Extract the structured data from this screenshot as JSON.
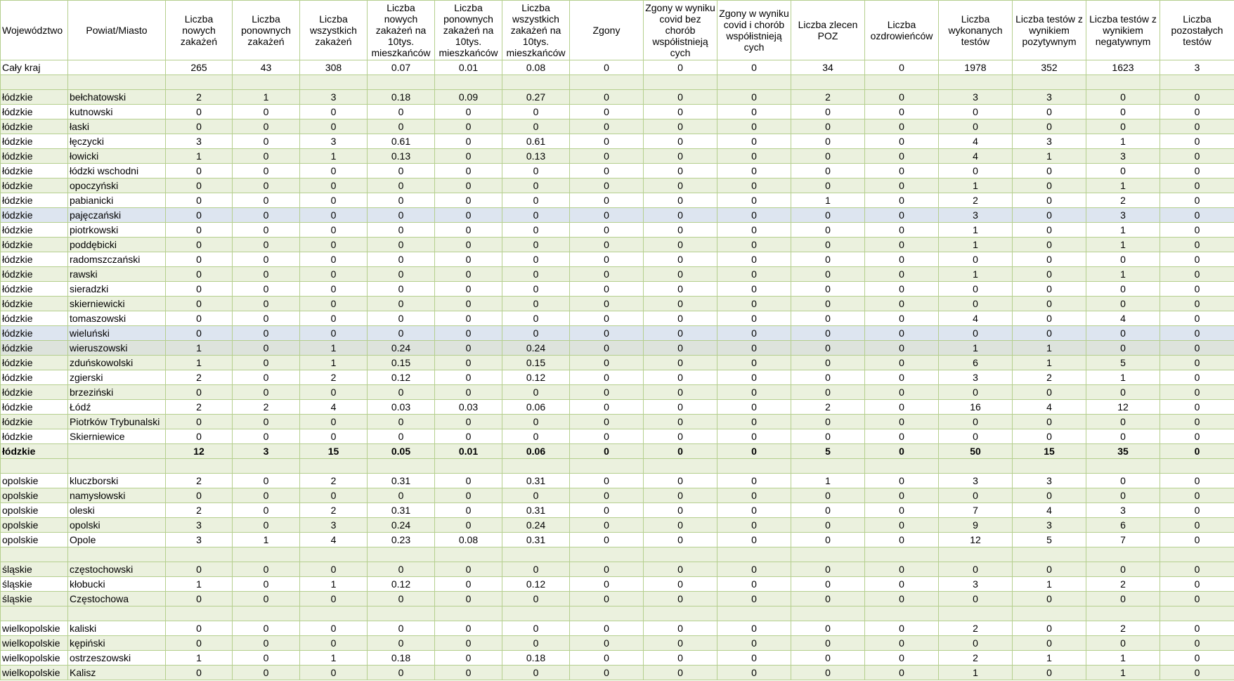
{
  "columns": [
    "Województwo",
    "Powiat/Miasto",
    "Liczba nowych zakażeń",
    "Liczba ponownych zakażeń",
    "Liczba wszystkich zakażeń",
    "Liczba nowych zakażeń na 10tys. mieszkańców",
    "Liczba ponownych zakażeń na 10tys. mieszkańców",
    "Liczba wszystkich zakażeń na 10tys. mieszkańców",
    "Zgony",
    "Zgony w wyniku covid bez chorób współistnieją cych",
    "Zgony w wyniku covid i chorób współistnieją cych",
    "Liczba zlecen POZ",
    "Liczba ozdrowieńców",
    "Liczba wykonanych testów",
    "Liczba testów z wynikiem pozytywnym",
    "Liczba testów z wynikiem negatywnym",
    "Liczba pozostałych testów"
  ],
  "rows": [
    {
      "cells": [
        "Cały kraj",
        "",
        "265",
        "43",
        "308",
        "0.07",
        "0.01",
        "0.08",
        "0",
        "0",
        "0",
        "34",
        "0",
        "1978",
        "352",
        "1623",
        "3"
      ]
    },
    {
      "blank": true,
      "cells": []
    },
    {
      "cells": [
        "łódzkie",
        "bełchatowski",
        "2",
        "1",
        "3",
        "0.18",
        "0.09",
        "0.27",
        "0",
        "0",
        "0",
        "2",
        "0",
        "3",
        "3",
        "0",
        "0"
      ]
    },
    {
      "cells": [
        "łódzkie",
        "kutnowski",
        "0",
        "0",
        "0",
        "0",
        "0",
        "0",
        "0",
        "0",
        "0",
        "0",
        "0",
        "0",
        "0",
        "0",
        "0"
      ]
    },
    {
      "cells": [
        "łódzkie",
        "łaski",
        "0",
        "0",
        "0",
        "0",
        "0",
        "0",
        "0",
        "0",
        "0",
        "0",
        "0",
        "0",
        "0",
        "0",
        "0"
      ]
    },
    {
      "cells": [
        "łódzkie",
        "łęczycki",
        "3",
        "0",
        "3",
        "0.61",
        "0",
        "0.61",
        "0",
        "0",
        "0",
        "0",
        "0",
        "4",
        "3",
        "1",
        "0"
      ]
    },
    {
      "cells": [
        "łódzkie",
        "łowicki",
        "1",
        "0",
        "1",
        "0.13",
        "0",
        "0.13",
        "0",
        "0",
        "0",
        "0",
        "0",
        "4",
        "1",
        "3",
        "0"
      ]
    },
    {
      "cells": [
        "łódzkie",
        "łódzki wschodni",
        "0",
        "0",
        "0",
        "0",
        "0",
        "0",
        "0",
        "0",
        "0",
        "0",
        "0",
        "0",
        "0",
        "0",
        "0"
      ]
    },
    {
      "cells": [
        "łódzkie",
        "opoczyński",
        "0",
        "0",
        "0",
        "0",
        "0",
        "0",
        "0",
        "0",
        "0",
        "0",
        "0",
        "1",
        "0",
        "1",
        "0"
      ]
    },
    {
      "cells": [
        "łódzkie",
        "pabianicki",
        "0",
        "0",
        "0",
        "0",
        "0",
        "0",
        "0",
        "0",
        "0",
        "1",
        "0",
        "2",
        "0",
        "2",
        "0"
      ]
    },
    {
      "state": "sel",
      "cells": [
        "łódzkie",
        "pajęczański",
        "0",
        "0",
        "0",
        "0",
        "0",
        "0",
        "0",
        "0",
        "0",
        "0",
        "0",
        "3",
        "0",
        "3",
        "0"
      ]
    },
    {
      "cells": [
        "łódzkie",
        "piotrkowski",
        "0",
        "0",
        "0",
        "0",
        "0",
        "0",
        "0",
        "0",
        "0",
        "0",
        "0",
        "1",
        "0",
        "1",
        "0"
      ]
    },
    {
      "cells": [
        "łódzkie",
        "poddębicki",
        "0",
        "0",
        "0",
        "0",
        "0",
        "0",
        "0",
        "0",
        "0",
        "0",
        "0",
        "1",
        "0",
        "1",
        "0"
      ]
    },
    {
      "cells": [
        "łódzkie",
        "radomszczański",
        "0",
        "0",
        "0",
        "0",
        "0",
        "0",
        "0",
        "0",
        "0",
        "0",
        "0",
        "0",
        "0",
        "0",
        "0"
      ]
    },
    {
      "cells": [
        "łódzkie",
        "rawski",
        "0",
        "0",
        "0",
        "0",
        "0",
        "0",
        "0",
        "0",
        "0",
        "0",
        "0",
        "1",
        "0",
        "1",
        "0"
      ]
    },
    {
      "cells": [
        "łódzkie",
        "sieradzki",
        "0",
        "0",
        "0",
        "0",
        "0",
        "0",
        "0",
        "0",
        "0",
        "0",
        "0",
        "0",
        "0",
        "0",
        "0"
      ]
    },
    {
      "cells": [
        "łódzkie",
        "skierniewicki",
        "0",
        "0",
        "0",
        "0",
        "0",
        "0",
        "0",
        "0",
        "0",
        "0",
        "0",
        "0",
        "0",
        "0",
        "0"
      ]
    },
    {
      "cells": [
        "łódzkie",
        "tomaszowski",
        "0",
        "0",
        "0",
        "0",
        "0",
        "0",
        "0",
        "0",
        "0",
        "0",
        "0",
        "4",
        "0",
        "4",
        "0"
      ]
    },
    {
      "state": "sel",
      "cells": [
        "łódzkie",
        "wieluński",
        "0",
        "0",
        "0",
        "0",
        "0",
        "0",
        "0",
        "0",
        "0",
        "0",
        "0",
        "0",
        "0",
        "0",
        "0"
      ]
    },
    {
      "state": "hover",
      "cells": [
        "łódzkie",
        "wieruszowski",
        "1",
        "0",
        "1",
        "0.24",
        "0",
        "0.24",
        "0",
        "0",
        "0",
        "0",
        "0",
        "1",
        "1",
        "0",
        "0"
      ]
    },
    {
      "cells": [
        "łódzkie",
        "zduńskowolski",
        "1",
        "0",
        "1",
        "0.15",
        "0",
        "0.15",
        "0",
        "0",
        "0",
        "0",
        "0",
        "6",
        "1",
        "5",
        "0"
      ]
    },
    {
      "cells": [
        "łódzkie",
        "zgierski",
        "2",
        "0",
        "2",
        "0.12",
        "0",
        "0.12",
        "0",
        "0",
        "0",
        "0",
        "0",
        "3",
        "2",
        "1",
        "0"
      ]
    },
    {
      "cells": [
        "łódzkie",
        "brzeziński",
        "0",
        "0",
        "0",
        "0",
        "0",
        "0",
        "0",
        "0",
        "0",
        "0",
        "0",
        "0",
        "0",
        "0",
        "0"
      ]
    },
    {
      "cells": [
        "łódzkie",
        "Łódź",
        "2",
        "2",
        "4",
        "0.03",
        "0.03",
        "0.06",
        "0",
        "0",
        "0",
        "2",
        "0",
        "16",
        "4",
        "12",
        "0"
      ]
    },
    {
      "cells": [
        "łódzkie",
        "Piotrków Trybunalski",
        "0",
        "0",
        "0",
        "0",
        "0",
        "0",
        "0",
        "0",
        "0",
        "0",
        "0",
        "0",
        "0",
        "0",
        "0"
      ]
    },
    {
      "cells": [
        "łódzkie",
        "Skierniewice",
        "0",
        "0",
        "0",
        "0",
        "0",
        "0",
        "0",
        "0",
        "0",
        "0",
        "0",
        "0",
        "0",
        "0",
        "0"
      ]
    },
    {
      "total": true,
      "cells": [
        "łódzkie",
        "",
        "12",
        "3",
        "15",
        "0.05",
        "0.01",
        "0.06",
        "0",
        "0",
        "0",
        "5",
        "0",
        "50",
        "15",
        "35",
        "0"
      ]
    },
    {
      "blank": true,
      "cells": []
    },
    {
      "cells": [
        "opolskie",
        "kluczborski",
        "2",
        "0",
        "2",
        "0.31",
        "0",
        "0.31",
        "0",
        "0",
        "0",
        "1",
        "0",
        "3",
        "3",
        "0",
        "0"
      ]
    },
    {
      "cells": [
        "opolskie",
        "namysłowski",
        "0",
        "0",
        "0",
        "0",
        "0",
        "0",
        "0",
        "0",
        "0",
        "0",
        "0",
        "0",
        "0",
        "0",
        "0"
      ]
    },
    {
      "cells": [
        "opolskie",
        "oleski",
        "2",
        "0",
        "2",
        "0.31",
        "0",
        "0.31",
        "0",
        "0",
        "0",
        "0",
        "0",
        "7",
        "4",
        "3",
        "0"
      ]
    },
    {
      "cells": [
        "opolskie",
        "opolski",
        "3",
        "0",
        "3",
        "0.24",
        "0",
        "0.24",
        "0",
        "0",
        "0",
        "0",
        "0",
        "9",
        "3",
        "6",
        "0"
      ]
    },
    {
      "cells": [
        "opolskie",
        "Opole",
        "3",
        "1",
        "4",
        "0.23",
        "0.08",
        "0.31",
        "0",
        "0",
        "0",
        "0",
        "0",
        "12",
        "5",
        "7",
        "0"
      ]
    },
    {
      "blank": true,
      "cells": []
    },
    {
      "cells": [
        "śląskie",
        "częstochowski",
        "0",
        "0",
        "0",
        "0",
        "0",
        "0",
        "0",
        "0",
        "0",
        "0",
        "0",
        "0",
        "0",
        "0",
        "0"
      ]
    },
    {
      "cells": [
        "śląskie",
        "kłobucki",
        "1",
        "0",
        "1",
        "0.12",
        "0",
        "0.12",
        "0",
        "0",
        "0",
        "0",
        "0",
        "3",
        "1",
        "2",
        "0"
      ]
    },
    {
      "cells": [
        "śląskie",
        "Częstochowa",
        "0",
        "0",
        "0",
        "0",
        "0",
        "0",
        "0",
        "0",
        "0",
        "0",
        "0",
        "0",
        "0",
        "0",
        "0"
      ]
    },
    {
      "blank": true,
      "cells": []
    },
    {
      "cells": [
        "wielkopolskie",
        "kaliski",
        "0",
        "0",
        "0",
        "0",
        "0",
        "0",
        "0",
        "0",
        "0",
        "0",
        "0",
        "2",
        "0",
        "2",
        "0"
      ]
    },
    {
      "cells": [
        "wielkopolskie",
        "kępiński",
        "0",
        "0",
        "0",
        "0",
        "0",
        "0",
        "0",
        "0",
        "0",
        "0",
        "0",
        "0",
        "0",
        "0",
        "0"
      ]
    },
    {
      "cells": [
        "wielkopolskie",
        "ostrzeszowski",
        "1",
        "0",
        "1",
        "0.18",
        "0",
        "0.18",
        "0",
        "0",
        "0",
        "0",
        "0",
        "2",
        "1",
        "1",
        "0"
      ]
    },
    {
      "cells": [
        "wielkopolskie",
        "Kalisz",
        "0",
        "0",
        "0",
        "0",
        "0",
        "0",
        "0",
        "0",
        "0",
        "0",
        "0",
        "1",
        "0",
        "1",
        "0"
      ]
    }
  ]
}
